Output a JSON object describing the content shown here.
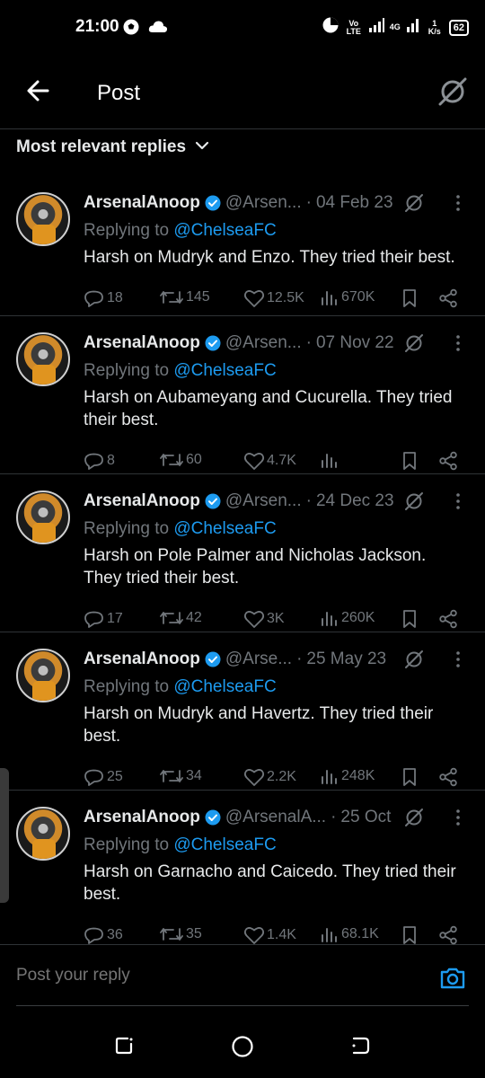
{
  "status_bar": {
    "time": "21:00",
    "network_a": "Vo LTE",
    "network_b": "4G",
    "speed": "1 K/s",
    "battery": "62"
  },
  "header": {
    "title": "Post"
  },
  "sort": {
    "label": "Most relevant replies"
  },
  "replies": [
    {
      "name": "ArsenalAnoop",
      "handle": "@Arsen...",
      "date": "04 Feb 23",
      "replying_prefix": "Replying to ",
      "replying_to": "@ChelseaFC",
      "text": "Harsh on Mudryk and Enzo. They tried their best.",
      "replies": "18",
      "reposts": "145",
      "likes": "12.5K",
      "views": "670K"
    },
    {
      "name": "ArsenalAnoop",
      "handle": "@Arsen...",
      "date": "07 Nov 22",
      "replying_prefix": "Replying to ",
      "replying_to": "@ChelseaFC",
      "text": "Harsh on Aubameyang and Cucurella. They tried their best.",
      "replies": "8",
      "reposts": "60",
      "likes": "4.7K",
      "views": ""
    },
    {
      "name": "ArsenalAnoop",
      "handle": "@Arsen...",
      "date": "24 Dec 23",
      "replying_prefix": "Replying to ",
      "replying_to": "@ChelseaFC",
      "text": "Harsh on Pole Palmer and Nicholas Jackson. They tried their best.",
      "replies": "17",
      "reposts": "42",
      "likes": "3K",
      "views": "260K"
    },
    {
      "name": "ArsenalAnoop",
      "handle": "@Arse...",
      "date": "25 May 23",
      "replying_prefix": "Replying to ",
      "replying_to": "@ChelseaFC",
      "text": "Harsh on Mudryk and Havertz. They tried their best.",
      "replies": "25",
      "reposts": "34",
      "likes": "2.2K",
      "views": "248K"
    },
    {
      "name": "ArsenalAnoop",
      "handle": "@ArsenalA...",
      "date": "25 Oct",
      "replying_prefix": "Replying to ",
      "replying_to": "@ChelseaFC",
      "text": "Harsh on Garnacho  and Caicedo. They tried their best.",
      "replies": "36",
      "reposts": "35",
      "likes": "1.4K",
      "views": "68.1K"
    }
  ],
  "composer": {
    "placeholder": "Post your reply"
  },
  "colors": {
    "accent": "#1d9bf0",
    "muted": "#71767b",
    "background": "#000000",
    "divider": "#2f3336"
  }
}
